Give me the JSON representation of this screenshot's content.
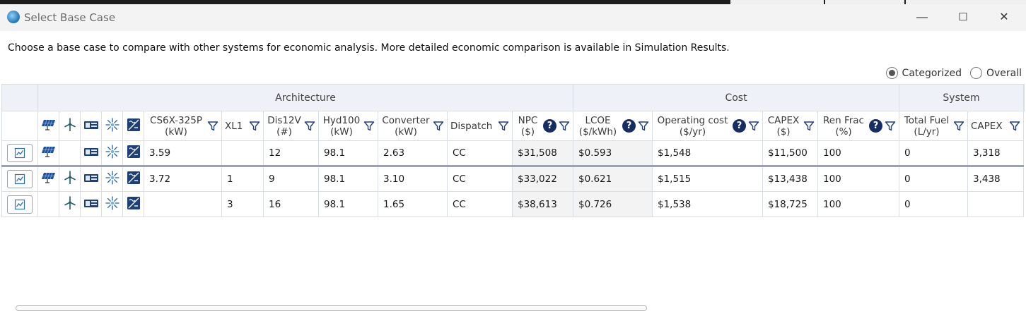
{
  "window": {
    "title": "Select Base Case",
    "minimize": "—",
    "maximize": "☐",
    "close": "✕"
  },
  "description": "Choose a base case to compare with other systems for economic analysis. More detailed economic comparison is available in Simulation Results.",
  "view_mode": {
    "options": [
      "Categorized",
      "Overall"
    ],
    "selected": "Categorized"
  },
  "table": {
    "groups": {
      "architecture": "Architecture",
      "cost": "Cost",
      "system": "System"
    },
    "columns": {
      "pv": {
        "name": "CS6X-325P",
        "unit": "(kW)"
      },
      "wind": {
        "name": "XL1",
        "unit": ""
      },
      "gen": {
        "name": "Dis12V",
        "unit": "(#)"
      },
      "hyd": {
        "name": "Hyd100",
        "unit": "(kW)"
      },
      "conv": {
        "name": "Converter",
        "unit": "(kW)"
      },
      "dispatch": {
        "name": "Dispatch",
        "unit": ""
      },
      "npc": {
        "name": "NPC",
        "unit": "($)"
      },
      "lcoe": {
        "name": "LCOE",
        "unit": "($/kWh)"
      },
      "opcost": {
        "name": "Operating cost",
        "unit": "($/yr)"
      },
      "capex": {
        "name": "CAPEX",
        "unit": "($)"
      },
      "renfrac": {
        "name": "Ren Frac",
        "unit": "(%)"
      },
      "fuel": {
        "name": "Total Fuel",
        "unit": "(L/yr)"
      },
      "capex2": {
        "name": "CAPEX",
        "unit": ""
      }
    },
    "help_glyph": "?",
    "rows": [
      {
        "pv": "3.59",
        "wind": "",
        "gen": "12",
        "hyd": "98.1",
        "conv": "2.63",
        "dispatch": "CC",
        "npc": "$31,508",
        "lcoe": "$0.593",
        "opcost": "$1,548",
        "capex": "$11,500",
        "renfrac": "100",
        "fuel": "0",
        "capex2": "3,318",
        "has_pv": true,
        "has_wind": false
      },
      {
        "pv": "3.72",
        "wind": "1",
        "gen": "9",
        "hyd": "98.1",
        "conv": "3.10",
        "dispatch": "CC",
        "npc": "$33,022",
        "lcoe": "$0.621",
        "opcost": "$1,515",
        "capex": "$13,438",
        "renfrac": "100",
        "fuel": "0",
        "capex2": "3,438",
        "has_pv": true,
        "has_wind": true
      },
      {
        "pv": "",
        "wind": "3",
        "gen": "16",
        "hyd": "98.1",
        "conv": "1.65",
        "dispatch": "CC",
        "npc": "$38,613",
        "lcoe": "$0.726",
        "opcost": "$1,538",
        "capex": "$18,725",
        "renfrac": "100",
        "fuel": "0",
        "capex2": "",
        "has_pv": false,
        "has_wind": true
      }
    ]
  },
  "colors": {
    "help_badge": "#162d63",
    "icon_blue": "#1f3f7a",
    "group_header_bg": "#eef2f8",
    "shade": "#f3f3f3"
  }
}
